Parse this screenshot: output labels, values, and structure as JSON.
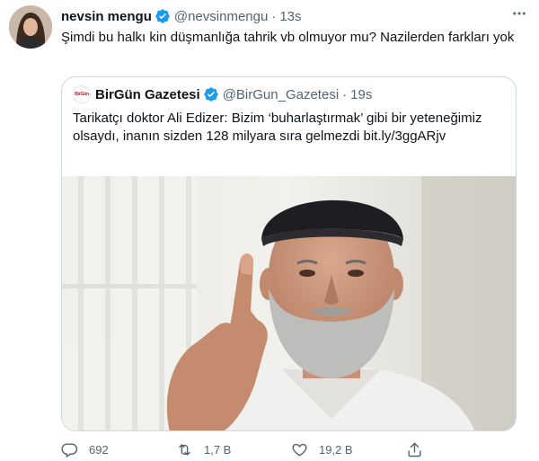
{
  "tweet": {
    "name": "nevsin mengu",
    "handle": "@nevsinmengu",
    "separator": "·",
    "time": "13s",
    "text": "Şimdi bu halkı kin düşmanlığa tahrik vb olmuyor mu? Nazilerden farkları yok",
    "more_icon": "more-icon"
  },
  "quoted": {
    "logo_text": "BirGün",
    "name": "BirGün Gazetesi",
    "handle": "@BirGun_Gazetesi",
    "separator": "·",
    "time": "19s",
    "text": "Tarikatçı doktor Ali Edizer: Bizim ‘buharlaştırmak’ gibi bir yeteneğimiz olsaydı, inanın sizden 128 milyara sıra gelmezdi bit.ly/3ggARjv"
  },
  "actions": {
    "reply_count": "692",
    "retweet_count": "1,7 B",
    "like_count": "19,2 B"
  },
  "colors": {
    "verified": "#1d9bf0",
    "muted": "#536471",
    "border": "#cfd9de",
    "text": "#0f1419"
  }
}
